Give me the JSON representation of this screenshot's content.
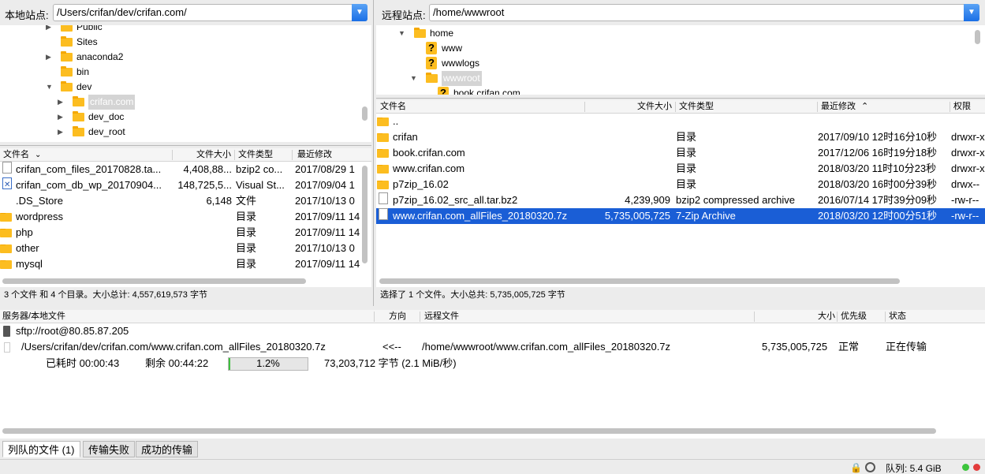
{
  "local_site": {
    "label": "本地站点:",
    "path": "/Users/crifan/dev/crifan.com/"
  },
  "remote_site": {
    "label": "远程站点:",
    "path": "/home/wwwroot"
  },
  "local_tree": [
    {
      "name": "Public",
      "expander": "▶"
    },
    {
      "name": "Sites",
      "expander": ""
    },
    {
      "name": "anaconda2",
      "expander": "▶"
    },
    {
      "name": "bin",
      "expander": ""
    },
    {
      "name": "dev",
      "expander": "▼"
    },
    {
      "name": "crifan.com",
      "expander": "▶"
    },
    {
      "name": "dev_doc",
      "expander": "▶"
    },
    {
      "name": "dev_root",
      "expander": "▶"
    }
  ],
  "remote_tree": [
    {
      "name": "home",
      "expander": "▼"
    },
    {
      "name": "www",
      "expander": ""
    },
    {
      "name": "wwwlogs",
      "expander": ""
    },
    {
      "name": "wwwroot",
      "expander": "▼"
    },
    {
      "name": "book.crifan.com",
      "expander": ""
    }
  ],
  "local_headers": {
    "name": "文件名",
    "size": "文件大小",
    "type": "文件类型",
    "modified": "最近修改"
  },
  "local_files": [
    {
      "name": "crifan_com_files_20170828.ta...",
      "size": "4,408,88...",
      "type": "bzip2 co...",
      "modified": "2017/08/29 1",
      "icon": "file-icon"
    },
    {
      "name": "crifan_com_db_wp_20170904...",
      "size": "148,725,5...",
      "type": "Visual St...",
      "modified": "2017/09/04 1",
      "icon": "vs-file-icon"
    },
    {
      "name": ".DS_Store",
      "size": "6,148",
      "type": "文件",
      "modified": "2017/10/13 0",
      "icon": "blank"
    },
    {
      "name": "wordpress",
      "size": "",
      "type": "目录",
      "modified": "2017/09/11 14",
      "icon": "folder-icon"
    },
    {
      "name": "php",
      "size": "",
      "type": "目录",
      "modified": "2017/09/11 14",
      "icon": "folder-icon"
    },
    {
      "name": "other",
      "size": "",
      "type": "目录",
      "modified": "2017/10/13 0",
      "icon": "folder-icon"
    },
    {
      "name": "mysql",
      "size": "",
      "type": "目录",
      "modified": "2017/09/11 14",
      "icon": "folder-icon"
    }
  ],
  "local_status": "3 个文件 和 4 个目录。大小总计: 4,557,619,573 字节",
  "remote_headers": {
    "name": "文件名",
    "size": "文件大小",
    "type": "文件类型",
    "modified": "最近修改",
    "perms": "权限"
  },
  "remote_files": [
    {
      "name": "..",
      "size": "",
      "type": "",
      "modified": "",
      "perms": "",
      "icon": "folder-icon"
    },
    {
      "name": "crifan",
      "size": "",
      "type": "目录",
      "modified": "2017/09/10 12时16分10秒",
      "perms": "drwxr-x",
      "icon": "folder-icon"
    },
    {
      "name": "book.crifan.com",
      "size": "",
      "type": "目录",
      "modified": "2017/12/06 16时19分18秒",
      "perms": "drwxr-x",
      "icon": "folder-icon"
    },
    {
      "name": "www.crifan.com",
      "size": "",
      "type": "目录",
      "modified": "2018/03/20 11时10分23秒",
      "perms": "drwxr-x",
      "icon": "folder-icon"
    },
    {
      "name": "p7zip_16.02",
      "size": "",
      "type": "目录",
      "modified": "2018/03/20 16时00分39秒",
      "perms": "drwx--",
      "icon": "folder-icon"
    },
    {
      "name": "p7zip_16.02_src_all.tar.bz2",
      "size": "4,239,909",
      "type": "bzip2 compressed archive",
      "modified": "2016/07/14 17时39分09秒",
      "perms": "-rw-r--",
      "icon": "file-icon"
    },
    {
      "name": "www.crifan.com_allFiles_20180320.7z",
      "size": "5,735,005,725",
      "type": "7-Zip Archive",
      "modified": "2018/03/20 12时00分51秒",
      "perms": "-rw-r--",
      "icon": "file-icon",
      "selected": true
    }
  ],
  "remote_status": "选择了 1 个文件。大小总共: 5,735,005,725 字节",
  "queue_headers": {
    "server": "服务器/本地文件",
    "direction": "方向",
    "remote": "远程文件",
    "size": "大小",
    "priority": "优先级",
    "status": "状态"
  },
  "queue": {
    "server": "sftp://root@80.85.87.205",
    "local_file": "/Users/crifan/dev/crifan.com/www.crifan.com_allFiles_20180320.7z",
    "direction": "<<--",
    "remote_file": "/home/wwwroot/www.crifan.com_allFiles_20180320.7z",
    "size": "5,735,005,725",
    "priority": "正常",
    "status": "正在传输",
    "elapsed": "已耗时 00:00:43",
    "remaining": "剩余 00:44:22",
    "progress_text": "1.2%",
    "progress_fraction": 0.012,
    "bytes": "73,203,712 字节 (2.1 MiB/秒)"
  },
  "tabs": [
    {
      "label": "列队的文件 (1)",
      "active": true
    },
    {
      "label": "传输失败",
      "active": false
    },
    {
      "label": "成功的传输",
      "active": false
    }
  ],
  "footer": {
    "queue_label": "队列: 5.4 GiB"
  },
  "colors": {
    "selection": "#1a5ed6",
    "folder": "#fcbd20",
    "accent": "#1a6fe6"
  }
}
